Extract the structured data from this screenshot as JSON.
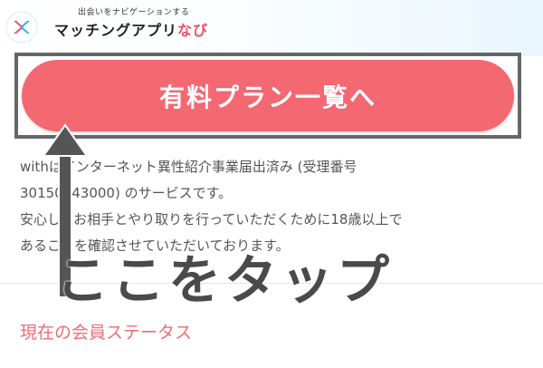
{
  "header": {
    "tagline": "出会いをナビゲーションする",
    "app_name_main": "マッチングアプリ",
    "app_name_accent": "なび",
    "logo_icon": "pink-blue-chevrons-logo"
  },
  "plan_button": {
    "label": "有料プラン一覧へ"
  },
  "notice": {
    "line1": "withはインターネット異性紹介事業届出済み (受理番号",
    "line2": "30150043000) のサービスです。",
    "line3": "安心してお相手とやり取りを行っていただくために18歳以上で",
    "line4": "あることを確認させていただいております。"
  },
  "status_link": {
    "label": "現在の会員ステータス"
  },
  "annotation": {
    "label": "ここをタップ",
    "arrow_icon": "up-arrow-icon"
  },
  "colors": {
    "button": "#f46872",
    "accent": "#ef4e6a",
    "highlight_border": "#666666",
    "logo_pink": "#ef4e6a",
    "logo_blue": "#2bb3e8"
  }
}
